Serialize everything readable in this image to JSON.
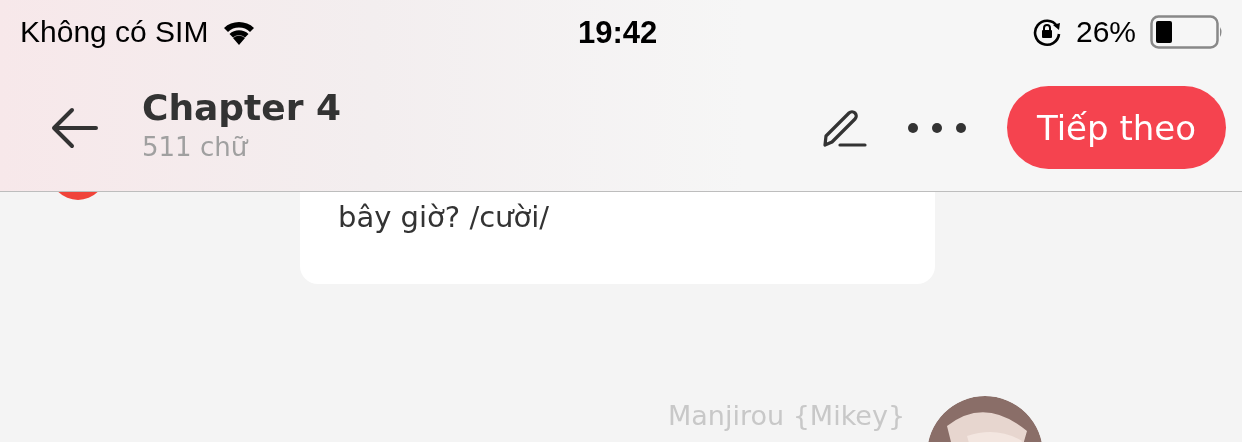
{
  "status_bar": {
    "carrier": "Không có SIM",
    "time": "19:42",
    "battery": "26%"
  },
  "header": {
    "title": "Chapter 4",
    "subtitle": "511 chữ",
    "next_button": "Tiếp theo"
  },
  "messages": [
    {
      "kind": "bubble",
      "text": "bây giờ? /cười/"
    },
    {
      "kind": "name",
      "text": "Manjirou {Mikey}"
    }
  ]
}
